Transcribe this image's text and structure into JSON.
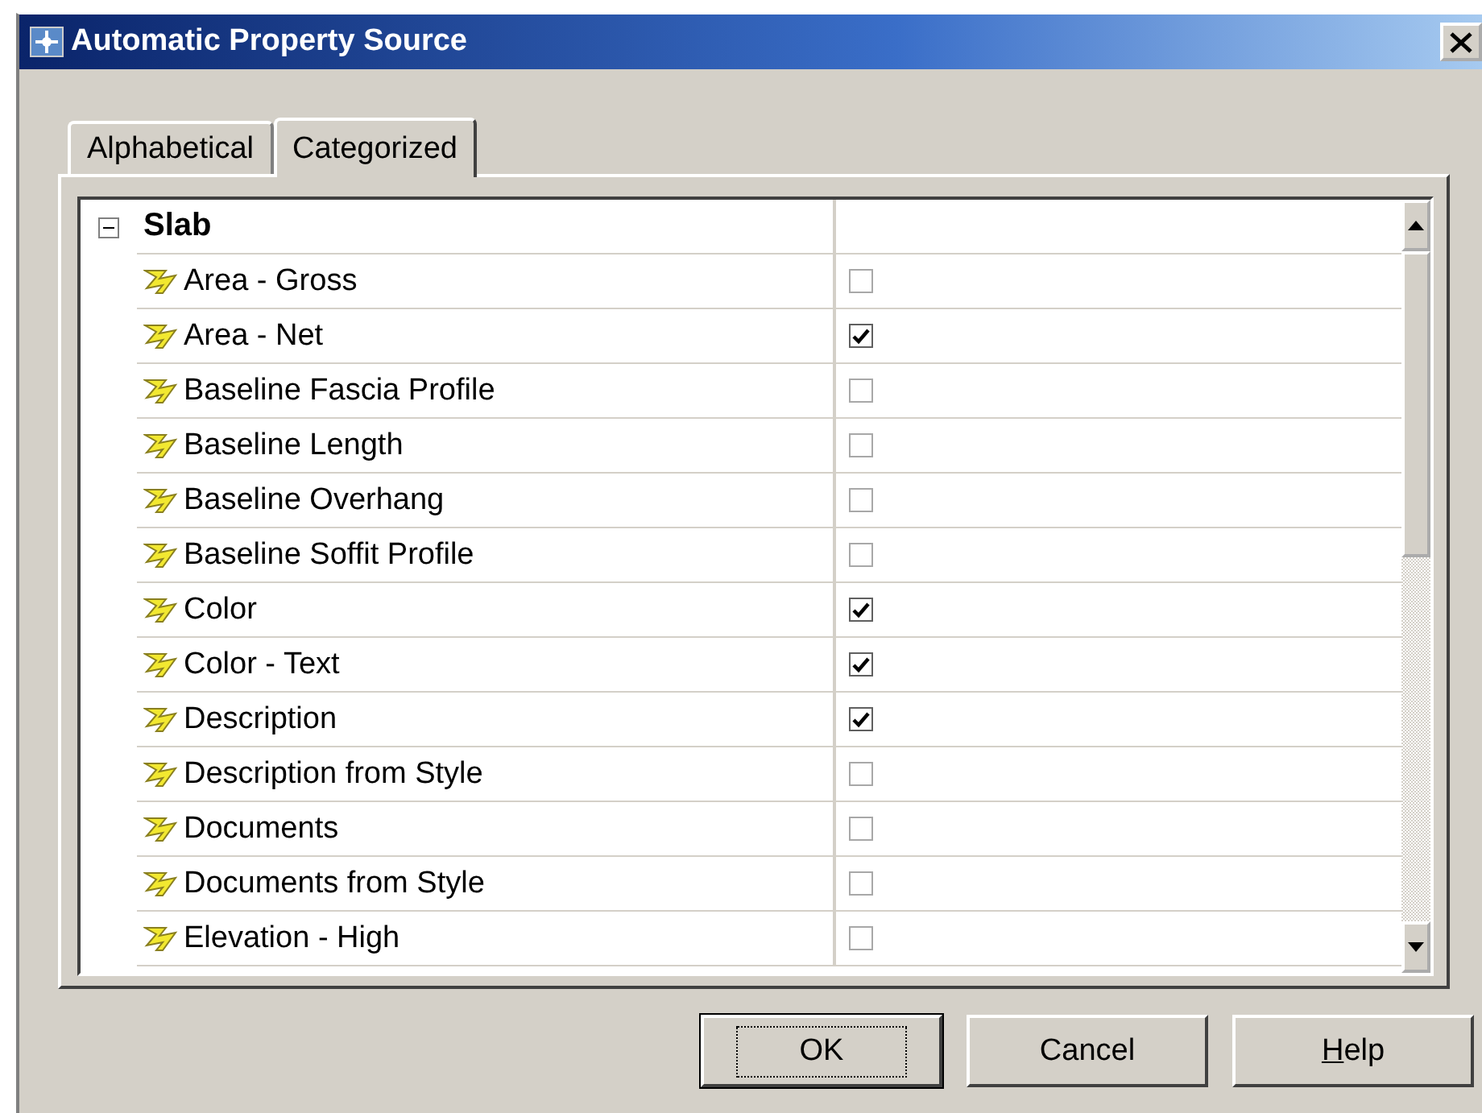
{
  "window": {
    "title": "Automatic Property Source"
  },
  "tabs": [
    {
      "label": "Alphabetical",
      "selected": false
    },
    {
      "label": "Categorized",
      "selected": true
    }
  ],
  "grid": {
    "category": {
      "name": "Slab",
      "expanded": true
    },
    "rows": [
      {
        "name": "Area - Gross",
        "checked": false
      },
      {
        "name": "Area - Net",
        "checked": true
      },
      {
        "name": "Baseline Fascia Profile",
        "checked": false
      },
      {
        "name": "Baseline Length",
        "checked": false
      },
      {
        "name": "Baseline Overhang",
        "checked": false
      },
      {
        "name": "Baseline Soffit Profile",
        "checked": false
      },
      {
        "name": "Color",
        "checked": true
      },
      {
        "name": "Color - Text",
        "checked": true
      },
      {
        "name": "Description",
        "checked": true
      },
      {
        "name": "Description from Style",
        "checked": false
      },
      {
        "name": "Documents",
        "checked": false
      },
      {
        "name": "Documents from Style",
        "checked": false
      },
      {
        "name": "Elevation - High",
        "checked": false
      }
    ]
  },
  "buttons": [
    {
      "label": "OK",
      "focused": true
    },
    {
      "label": "Cancel",
      "focused": false
    },
    {
      "label": "Help",
      "focused": false,
      "underline_first_letter": true
    }
  ]
}
